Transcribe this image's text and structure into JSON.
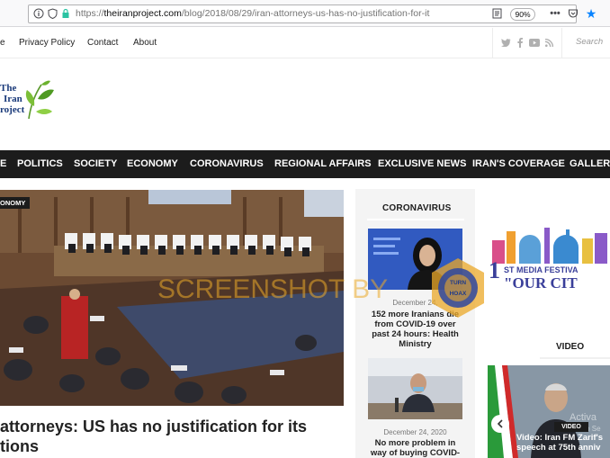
{
  "browser": {
    "url_scheme": "https://",
    "url_host": "theiranproject.com",
    "url_path": "/blog/2018/08/29/iran-attorneys-us-has-no-justification-for-it",
    "zoom": "90%"
  },
  "topnav": {
    "links": [
      "e",
      "Privacy Policy",
      "Contact",
      "About"
    ],
    "search_placeholder": "Search"
  },
  "logo": {
    "line1": "The",
    "line2": "Iran",
    "line3": "roject"
  },
  "mainnav": {
    "items": [
      "E",
      "POLITICS",
      "SOCIETY",
      "ECONOMY",
      "CORONAVIRUS",
      "REGIONAL AFFAIRS",
      "EXCLUSIVE NEWS",
      "IRAN'S COVERAGE",
      "GALLERY"
    ]
  },
  "hero": {
    "category": "ONOMY",
    "headline_line1": "attorneys: US has no justification for its",
    "headline_line2": "tions"
  },
  "sidebar": {
    "heading": "CORONAVIRUS",
    "cards": [
      {
        "date": "December 24,",
        "title": "152 more Iranians die from COVID-19 over past 24 hours: Health Ministry"
      },
      {
        "date": "December 24, 2020",
        "title": "No more problem in way of buying COVID-"
      }
    ]
  },
  "banner": {
    "line1": "ST MEDIA FESTIVA",
    "line2": "\"OUR CIT"
  },
  "video": {
    "heading": "VIDEO",
    "badge": "VIDEO",
    "title": "Video: Iran FM Zarif's speech at 75th anniv",
    "activate1": "Activa",
    "activate2": "Go to Se"
  },
  "watermark": {
    "text": "SCREENSHOT BY",
    "seal_top": "TURN",
    "seal_bottom": "HOAX"
  },
  "colors": {
    "nav_bg": "#1c1c1c",
    "accent_blue": "#0a84ff",
    "watermark": "#eba828"
  }
}
